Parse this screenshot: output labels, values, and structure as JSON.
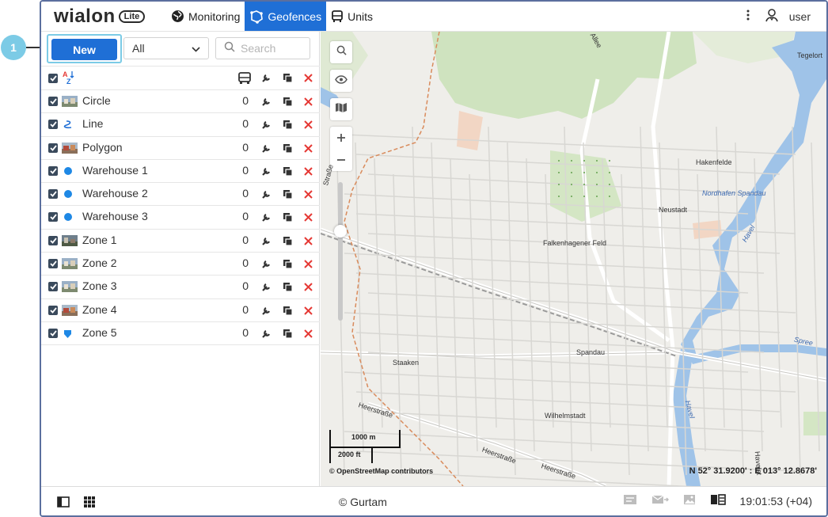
{
  "callout": {
    "number": "1"
  },
  "app": {
    "logo_word": "wialon",
    "logo_badge": "Lite"
  },
  "nav": {
    "items": [
      {
        "label": "Monitoring",
        "icon": "globe-icon",
        "active": false
      },
      {
        "label": "Geofences",
        "icon": "geofence-icon",
        "active": true
      },
      {
        "label": "Units",
        "icon": "bus-icon",
        "active": false
      }
    ]
  },
  "header": {
    "user": "user"
  },
  "toolbar": {
    "new_label": "New",
    "filter_value": "All",
    "search_placeholder": "Search"
  },
  "list": {
    "columns": [
      "select-all",
      "sort-az",
      "units",
      "edit",
      "copy",
      "delete"
    ],
    "geofences": [
      {
        "name": "Circle",
        "count": "0",
        "thumb": "photo"
      },
      {
        "name": "Line",
        "count": "0",
        "thumb": "line"
      },
      {
        "name": "Polygon",
        "count": "0",
        "thumb": "photo-red"
      },
      {
        "name": "Warehouse 1",
        "count": "0",
        "thumb": "dot"
      },
      {
        "name": "Warehouse 2",
        "count": "0",
        "thumb": "dot"
      },
      {
        "name": "Warehouse 3",
        "count": "0",
        "thumb": "dot"
      },
      {
        "name": "Zone 1",
        "count": "0",
        "thumb": "photo-dark"
      },
      {
        "name": "Zone 2",
        "count": "0",
        "thumb": "photo"
      },
      {
        "name": "Zone 3",
        "count": "0",
        "thumb": "photo"
      },
      {
        "name": "Zone 4",
        "count": "0",
        "thumb": "photo-red"
      },
      {
        "name": "Zone 5",
        "count": "0",
        "thumb": "shield"
      }
    ]
  },
  "map": {
    "labels": {
      "tegelort": "Tegelort",
      "hakenfelde": "Hakenfelde",
      "nordhafen": "Nordhafen Spandau",
      "neustadt": "Neustadt",
      "falkenhagener": "Falkenhagener Feld",
      "havel1": "Havel",
      "spree": "Spree",
      "spandau": "Spandau",
      "staaken": "Staaken",
      "wilhelmstadt": "Wilhelmstadt",
      "heerstrasse1": "Heerstraße",
      "heerstrasse2": "Heerstraße",
      "heerstrasse3": "Heerstraße",
      "havel2": "Havel",
      "allee": "Allee",
      "strasse_left": "Straße",
      "havelst": "Havelst"
    },
    "scale_m": "1000 m",
    "scale_ft": "2000 ft",
    "attribution": "© OpenStreetMap contributors",
    "coords": "N 52° 31.9200' : E 013° 12.8678'"
  },
  "footer": {
    "copyright": "© Gurtam",
    "time": "19:01:53 (+04)"
  },
  "colors": {
    "accent": "#1f6fd6",
    "delete": "#e53935",
    "callout": "#7ccbe6",
    "water": "#9fc3e8",
    "park": "#cfe3bf"
  }
}
